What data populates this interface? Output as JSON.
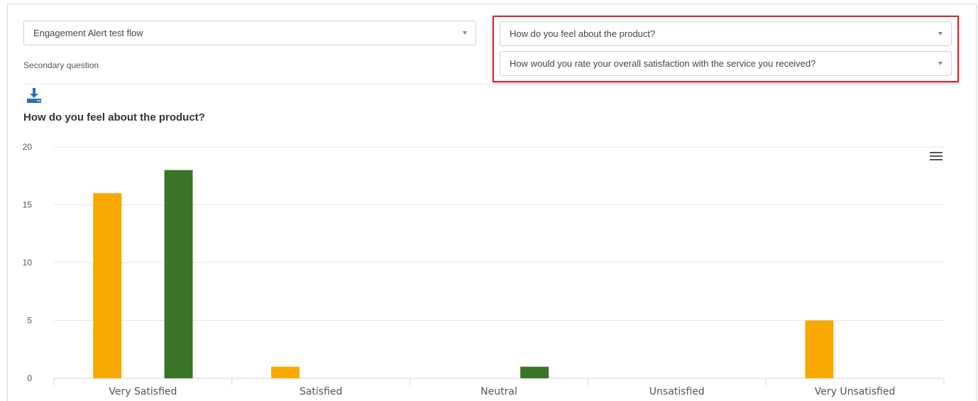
{
  "filters": {
    "flow_select": {
      "value": "Engagement Alert test flow"
    },
    "secondary_label": "Secondary question",
    "primary_question_select": {
      "value": "How do you feel about the product?"
    },
    "secondary_question_select": {
      "value": "How would you rate your overall satisfaction with the service you received?"
    }
  },
  "colors": {
    "highlight": "#d9262e",
    "series_1": "#f8a800",
    "series_2": "#3a7426",
    "download_icon": "#2b6fb5"
  },
  "icons": {
    "download": "download-icon",
    "menu": "hamburger-menu-icon"
  },
  "chart_data": {
    "type": "bar",
    "title": "How do you feel about the product?",
    "categories": [
      "Very Satisfied",
      "Satisfied",
      "Neutral",
      "Unsatisfied",
      "Very Unsatisfied"
    ],
    "series": [
      {
        "color": "#f8a800",
        "values": [
          16,
          1,
          0,
          0,
          5
        ]
      },
      {
        "color": "#3a7426",
        "values": [
          18,
          0,
          1,
          0,
          0
        ]
      }
    ],
    "yticks": [
      "0",
      "5",
      "10",
      "15",
      "20"
    ],
    "ylim": [
      0,
      20
    ],
    "grid": true,
    "legend": "none"
  }
}
